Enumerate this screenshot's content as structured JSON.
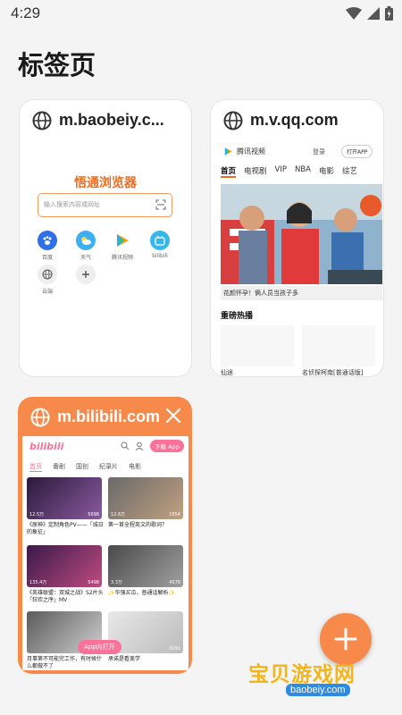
{
  "status_bar": {
    "time": "4:29"
  },
  "page_title": "标签页",
  "tabs": [
    {
      "url": "m.baobeiy.c...",
      "content": {
        "brand": "悟通浏览器",
        "search_placeholder": "输入搜索内容或网址",
        "shortcuts": [
          "百度",
          "天气",
          "腾讯视频",
          "bilibili",
          "云端"
        ]
      }
    },
    {
      "url": "m.v.qq.com",
      "content": {
        "logo_text": "腾讯视频",
        "login": "登录",
        "open_app": "打开APP",
        "nav": [
          "首页",
          "电视剧",
          "VIP",
          "NBA",
          "电影",
          "综艺"
        ],
        "banner_caption": "花颜怀孕！俩人员当孩子多",
        "section_title": "重磅热播",
        "thumb_titles": [
          "仙途",
          "名侦探柯南[普通话版]"
        ]
      }
    },
    {
      "url": "m.bilibili.com",
      "active": true,
      "content": {
        "logo": "bilibili",
        "download": "下载 App",
        "nav": [
          "首页",
          "番剧",
          "国创",
          "纪录片",
          "电影"
        ],
        "videos": [
          {
            "title": "《原神》定制角色PV——「城日的象征」",
            "views": "12.5万",
            "comments": "5698"
          },
          {
            "title": "第一首全程英文的歌词？",
            "views": "12.6万",
            "comments": "1654"
          },
          {
            "title": "《英雄联盟：双城之战》S2片头「狂欢之序」MV",
            "views": "135.4万",
            "comments": "5498"
          },
          {
            "title": "✨华强买瓜，普通话解析✨",
            "views": "3.3万",
            "comments": "4576"
          },
          {
            "title": "月事第不可能完工作，有时候什么都做不了",
            "views": "",
            "comments": ""
          },
          {
            "title": "承诺是看美学",
            "views": "",
            "comments": "4291"
          }
        ],
        "open_in_app": "App内打开"
      }
    }
  ],
  "watermark": {
    "text": "宝贝游戏网",
    "url": "baobeiy.com"
  },
  "colors": {
    "accent": "#f78a4a",
    "bili_pink": "#fb7299",
    "bg": "#f4f4f4"
  }
}
